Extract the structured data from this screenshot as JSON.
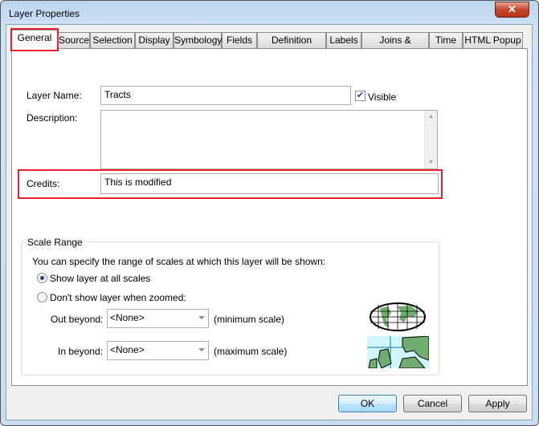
{
  "window": {
    "title": "Layer Properties",
    "close_icon": "close-icon"
  },
  "tabs": [
    {
      "label": "General",
      "selected": true
    },
    {
      "label": "Source"
    },
    {
      "label": "Selection"
    },
    {
      "label": "Display"
    },
    {
      "label": "Symbology"
    },
    {
      "label": "Fields"
    },
    {
      "label": "Definition Query"
    },
    {
      "label": "Labels"
    },
    {
      "label": "Joins & Relates"
    },
    {
      "label": "Time"
    },
    {
      "label": "HTML Popup"
    }
  ],
  "general": {
    "layer_name_label": "Layer Name:",
    "layer_name_value": "Tracts",
    "visible_label": "Visible",
    "visible_checked": true,
    "description_label": "Description:",
    "description_value": "",
    "credits_label": "Credits:",
    "credits_value": "This is modified",
    "highlight_color": "#e8202a"
  },
  "scale_range": {
    "title": "Scale Range",
    "intro": "You can specify the range of scales at which this layer will be shown:",
    "option_all": "Show layer at all scales",
    "option_all_selected": true,
    "option_zoomed": "Don't show layer when zoomed:",
    "out_beyond_label": "Out beyond:",
    "out_beyond_value": "<None>",
    "out_beyond_hint": "(minimum scale)",
    "in_beyond_label": "In beyond:",
    "in_beyond_value": "<None>",
    "in_beyond_hint": "(maximum scale)"
  },
  "buttons": {
    "ok": "OK",
    "cancel": "Cancel",
    "apply": "Apply"
  }
}
